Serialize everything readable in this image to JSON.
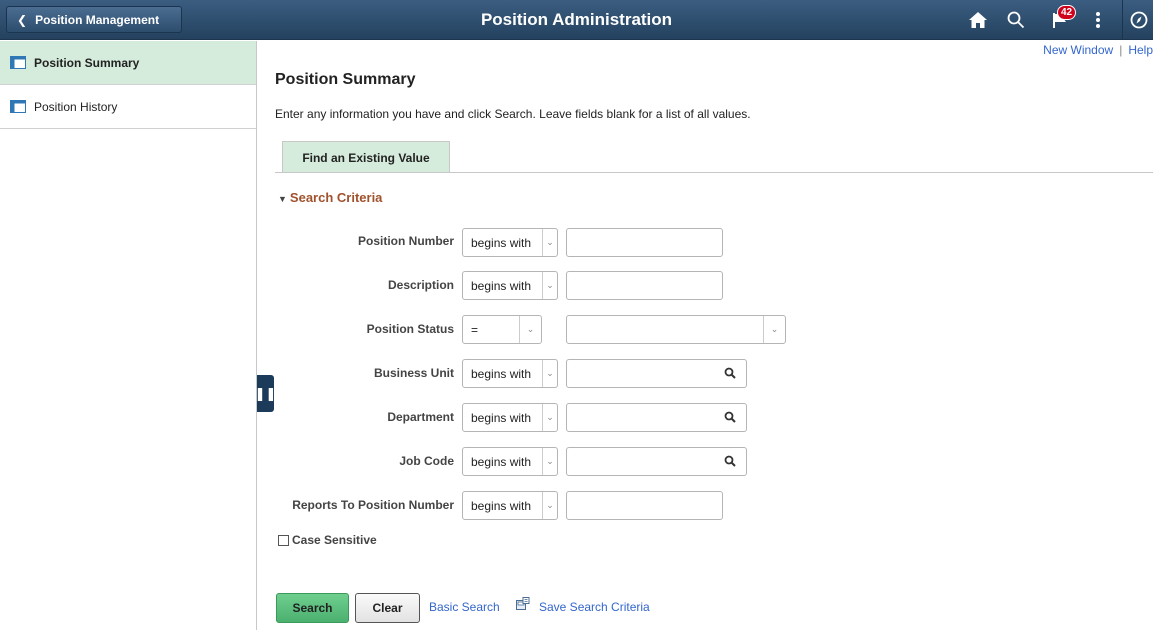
{
  "header": {
    "back_label": "Position Management",
    "title": "Position Administration",
    "notification_count": "42",
    "icons": [
      "home-icon",
      "search-icon",
      "notification-flag-icon",
      "actions-menu-icon",
      "navbar-compass-icon"
    ]
  },
  "sidebar": {
    "items": [
      {
        "label": "Position Summary",
        "active": true
      },
      {
        "label": "Position History",
        "active": false
      }
    ]
  },
  "toplinks": {
    "new_window": "New Window",
    "separator": "|",
    "help": "Help"
  },
  "main": {
    "title": "Position Summary",
    "instructions": "Enter any information you have and click Search. Leave fields blank for a list of all values.",
    "tab": "Find an Existing Value",
    "section": "Search Criteria",
    "fields": [
      {
        "label": "Position Number",
        "operator": "begins with",
        "value": ""
      },
      {
        "label": "Description",
        "operator": "begins with",
        "value": ""
      },
      {
        "label": "Position Status",
        "operator": "=",
        "value": ""
      },
      {
        "label": "Business Unit",
        "operator": "begins with",
        "value": ""
      },
      {
        "label": "Department",
        "operator": "begins with",
        "value": ""
      },
      {
        "label": "Job Code",
        "operator": "begins with",
        "value": ""
      },
      {
        "label": "Reports To Position Number",
        "operator": "begins with",
        "value": ""
      }
    ],
    "case_sensitive_label": "Case Sensitive",
    "case_sensitive_checked": false
  },
  "actions": {
    "search": "Search",
    "clear": "Clear",
    "basic_search": "Basic Search",
    "save_search": "Save Search Criteria"
  },
  "colors": {
    "header": "#2d4d6d",
    "accent_green": "#d5ecdc",
    "section_heading": "#a0522d",
    "link": "#3366cc",
    "badge": "#d0021b"
  }
}
